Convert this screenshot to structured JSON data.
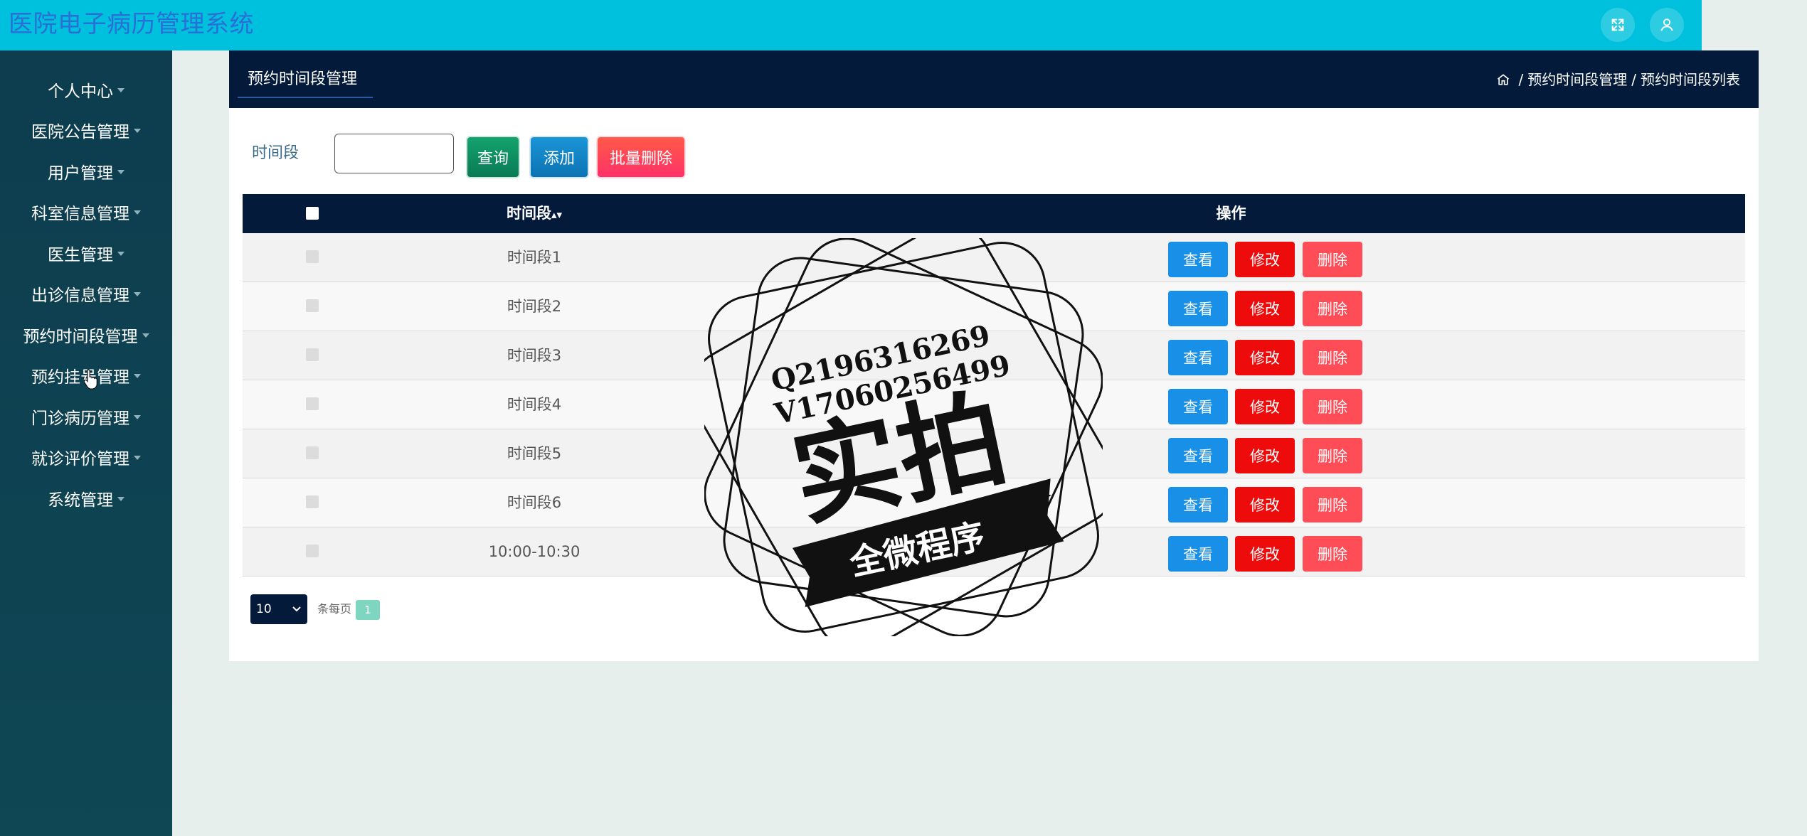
{
  "app": {
    "title": "医院电子病历管理系统"
  },
  "header_icons": [
    {
      "name": "fullscreen-icon"
    },
    {
      "name": "user-icon"
    }
  ],
  "sidebar": {
    "items": [
      {
        "label": "个人中心"
      },
      {
        "label": "医院公告管理"
      },
      {
        "label": "用户管理"
      },
      {
        "label": "科室信息管理"
      },
      {
        "label": "医生管理"
      },
      {
        "label": "出诊信息管理"
      },
      {
        "label": "预约时间段管理"
      },
      {
        "label": "预约挂号管理"
      },
      {
        "label": "门诊病历管理"
      },
      {
        "label": "就诊评价管理"
      },
      {
        "label": "系统管理"
      }
    ]
  },
  "page": {
    "tab": "预约时间段管理",
    "breadcrumb": {
      "sep1": "/",
      "level1": "预约时间段管理",
      "sep2": "/",
      "level2": "预约时间段列表"
    }
  },
  "search": {
    "label": "时间段",
    "value": "",
    "placeholder": "",
    "query_label": "查询",
    "add_label": "添加",
    "batch_delete_label": "批量删除"
  },
  "table": {
    "columns": {
      "time_slot": "时间段",
      "actions": "操作"
    },
    "action_labels": {
      "view": "查看",
      "edit": "修改",
      "delete": "删除"
    },
    "rows": [
      {
        "time_slot": "时间段1"
      },
      {
        "time_slot": "时间段2"
      },
      {
        "time_slot": "时间段3"
      },
      {
        "time_slot": "时间段4"
      },
      {
        "time_slot": "时间段5"
      },
      {
        "time_slot": "时间段6"
      },
      {
        "time_slot": "10:00-10:30"
      }
    ]
  },
  "pagination": {
    "page_size": "10",
    "per_page_text": "条每页",
    "current_page": "1"
  },
  "watermark": {
    "line1": "Q2196316269",
    "line2": "V17060256499",
    "main": "实拍",
    "banner": "全微程序"
  }
}
